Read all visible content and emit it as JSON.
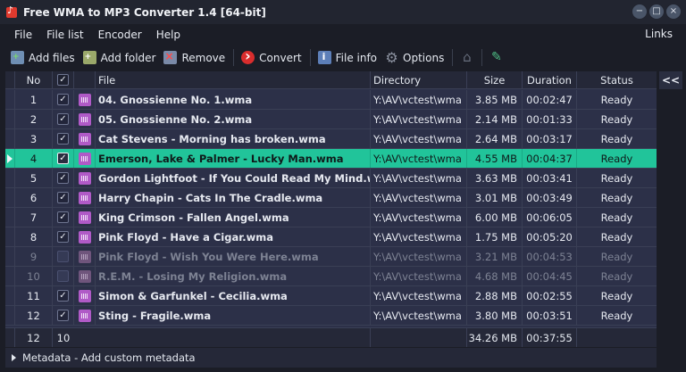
{
  "window": {
    "title": "Free WMA to MP3 Converter 1.4  [64-bit]",
    "controls": [
      "−",
      "□",
      "×"
    ]
  },
  "menu": {
    "items": [
      "File",
      "File list",
      "Encoder",
      "Help"
    ],
    "links": "Links"
  },
  "toolbar": {
    "add_files": "Add files",
    "add_folder": "Add folder",
    "remove": "Remove",
    "convert": "Convert",
    "file_info": "File info",
    "options": "Options"
  },
  "columns": {
    "no": "No",
    "file": "File",
    "directory": "Directory",
    "size": "Size",
    "duration": "Duration",
    "status": "Status"
  },
  "rows": [
    {
      "no": "1",
      "file": "04. Gnossienne No. 1.wma",
      "dir": "Y:\\AV\\vctest\\wma",
      "size": "3.85 MB",
      "duration": "00:02:47",
      "status": "Ready",
      "checked": true
    },
    {
      "no": "2",
      "file": "05. Gnossienne No. 2.wma",
      "dir": "Y:\\AV\\vctest\\wma",
      "size": "2.14 MB",
      "duration": "00:01:33",
      "status": "Ready",
      "checked": true
    },
    {
      "no": "3",
      "file": "Cat Stevens - Morning has broken.wma",
      "dir": "Y:\\AV\\vctest\\wma",
      "size": "2.64 MB",
      "duration": "00:03:17",
      "status": "Ready",
      "checked": true
    },
    {
      "no": "4",
      "file": "Emerson, Lake & Palmer - Lucky Man.wma",
      "dir": "Y:\\AV\\vctest\\wma",
      "size": "4.55 MB",
      "duration": "00:04:37",
      "status": "Ready",
      "checked": true,
      "selected": true
    },
    {
      "no": "5",
      "file": "Gordon Lightfoot - If You Could Read My Mind.wma",
      "dir": "Y:\\AV\\vctest\\wma",
      "size": "3.63 MB",
      "duration": "00:03:41",
      "status": "Ready",
      "checked": true
    },
    {
      "no": "6",
      "file": "Harry Chapin - Cats In The Cradle.wma",
      "dir": "Y:\\AV\\vctest\\wma",
      "size": "3.01 MB",
      "duration": "00:03:49",
      "status": "Ready",
      "checked": true
    },
    {
      "no": "7",
      "file": "King Crimson - Fallen Angel.wma",
      "dir": "Y:\\AV\\vctest\\wma",
      "size": "6.00 MB",
      "duration": "00:06:05",
      "status": "Ready",
      "checked": true
    },
    {
      "no": "8",
      "file": "Pink Floyd - Have a Cigar.wma",
      "dir": "Y:\\AV\\vctest\\wma",
      "size": "1.75 MB",
      "duration": "00:05:20",
      "status": "Ready",
      "checked": true
    },
    {
      "no": "9",
      "file": "Pink Floyd - Wish You Were Here.wma",
      "dir": "Y:\\AV\\vctest\\wma",
      "size": "3.21 MB",
      "duration": "00:04:53",
      "status": "Ready",
      "checked": false
    },
    {
      "no": "10",
      "file": "R.E.M. - Losing My Religion.wma",
      "dir": "Y:\\AV\\vctest\\wma",
      "size": "4.68 MB",
      "duration": "00:04:45",
      "status": "Ready",
      "checked": false
    },
    {
      "no": "11",
      "file": "Simon & Garfunkel - Cecilia.wma",
      "dir": "Y:\\AV\\vctest\\wma",
      "size": "2.88 MB",
      "duration": "00:02:55",
      "status": "Ready",
      "checked": true
    },
    {
      "no": "12",
      "file": "Sting - Fragile.wma",
      "dir": "Y:\\AV\\vctest\\wma",
      "size": "3.80 MB",
      "duration": "00:03:51",
      "status": "Ready",
      "checked": true
    }
  ],
  "footer": {
    "total_files": "12",
    "checked_files": "10",
    "total_size": "34.26 MB",
    "total_duration": "00:37:55"
  },
  "side_panel": {
    "collapse_label": "<<"
  },
  "metadata_bar": {
    "label": "Metadata - Add custom metadata"
  }
}
